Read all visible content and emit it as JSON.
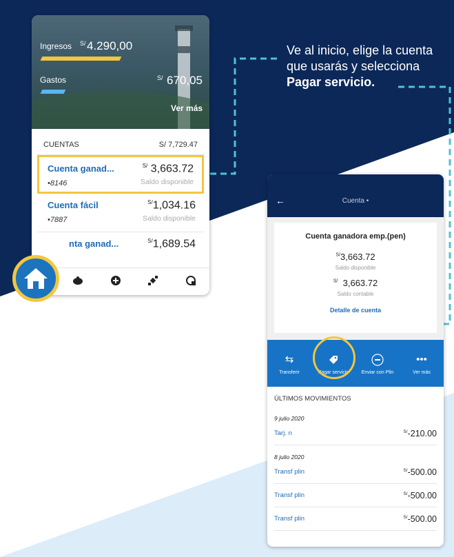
{
  "instruction": {
    "line1": "Ve al inicio, elige la cuenta",
    "line2": "que usarás y selecciona",
    "line3": "Pagar servicio."
  },
  "colors": {
    "navy": "#0c2859",
    "accent_yellow": "#f3c63f",
    "brand_blue": "#1773c5",
    "dashed_teal": "#4fc3d3"
  },
  "home": {
    "ingresos_label": "Ingresos",
    "ingresos_currency": "S/",
    "ingresos_value": "4.290,00",
    "gastos_label": "Gastos",
    "gastos_currency": "S/",
    "gastos_value": "670,05",
    "ver_mas": "Ver más",
    "cuentas_label": "CUENTAS",
    "cuentas_total": "S/ 7,729.47",
    "accounts": [
      {
        "name": "Cuenta ganad...",
        "number": "•8146",
        "currency": "S/",
        "value": "3,663.72",
        "label": "Saldo disponible"
      },
      {
        "name": "Cuenta fácil",
        "number": "•7887",
        "currency": "S/",
        "value": "1,034.16",
        "label": "Saldo disponible"
      },
      {
        "name": "nta ganad...",
        "currency": "S/",
        "value": "1,689.54"
      }
    ],
    "nav_icons": [
      "home-icon",
      "piggy-bank-icon",
      "plus-circle-icon",
      "satellite-icon",
      "clock-refresh-icon"
    ]
  },
  "account": {
    "back": "←",
    "title": "Cuenta •",
    "name": "Cuenta ganadora emp.(pen)",
    "disp_currency": "S/",
    "disp_value": "3,663.72",
    "disp_label": "Saldo disponible",
    "cont_currency": "S/",
    "cont_value": "3,663.72",
    "cont_label": "Saldo contable",
    "detail_link": "Detalle de cuenta",
    "actions": [
      {
        "label": "Transferir",
        "icon": "transfer-arrows-icon"
      },
      {
        "label": "Pagar servicio",
        "icon": "tag-icon"
      },
      {
        "label": "Enviar con Plin",
        "icon": "plin-icon"
      },
      {
        "label": "Ver más",
        "icon": "more-dots-icon"
      }
    ],
    "movements_title": "ÚLTIMOS MOVIMIENTOS",
    "groups": [
      {
        "date": "9 julio 2020",
        "items": [
          {
            "name": "Tarj. n",
            "currency": "S/",
            "amount": "-210.00"
          }
        ]
      },
      {
        "date": "8 julio 2020",
        "items": [
          {
            "name": "Transf plin",
            "currency": "S/",
            "amount": "-500.00"
          },
          {
            "name": "Transf plin",
            "currency": "S/",
            "amount": "-500.00"
          },
          {
            "name": "Transf plin",
            "currency": "S/",
            "amount": "-500.00"
          }
        ]
      }
    ]
  }
}
